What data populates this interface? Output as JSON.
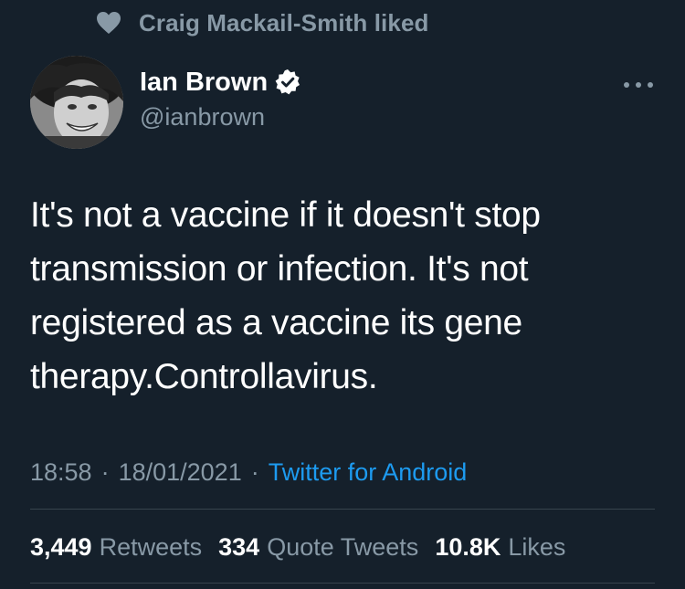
{
  "social_context": {
    "icon": "heart-icon",
    "text": "Craig Mackail-Smith liked"
  },
  "author": {
    "avatar_icon": "avatar",
    "display_name": "Ian Brown",
    "verified_icon": "verified-badge-icon",
    "handle": "@ianbrown"
  },
  "more_icon": "more-options-icon",
  "tweet": {
    "lines": [
      "It's not a vaccine if it doesn't stop",
      "transmission or infection. It's not",
      "registered as a vaccine its gene",
      "therapy.Controllavirus."
    ]
  },
  "meta": {
    "time": "18:58",
    "separator": "·",
    "date": "18/01/2021",
    "source": "Twitter for Android"
  },
  "stats": {
    "retweets": {
      "count": "3,449",
      "label": "Retweets"
    },
    "quotes": {
      "count": "334",
      "label": "Quote Tweets"
    },
    "likes": {
      "count": "10.8K",
      "label": "Likes"
    }
  },
  "colors": {
    "background": "#15202b",
    "secondary_text": "#8899a6",
    "link": "#1d9bf0",
    "divider": "#38444d"
  }
}
